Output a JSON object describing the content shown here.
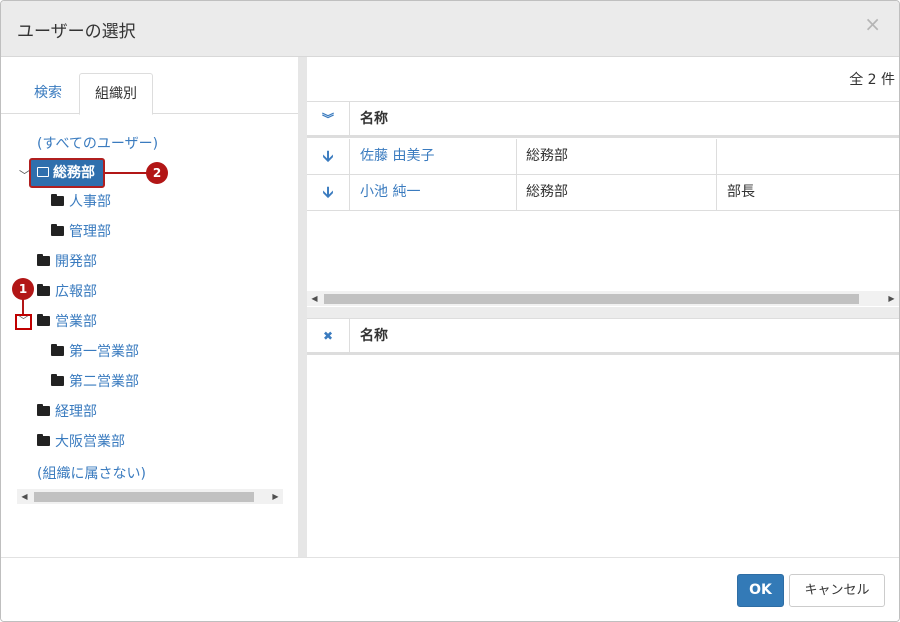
{
  "dialog": {
    "title": "ユーザーの選択",
    "close_icon": "×"
  },
  "left": {
    "tabs": [
      {
        "label": "検索"
      },
      {
        "label": "組織別"
      }
    ],
    "tree": {
      "all_users": "(すべてのユーザー)",
      "selected": "総務部",
      "children_selected": [
        "人事部",
        "管理部"
      ],
      "kaihatsu": "開発部",
      "kouhou": "広報部",
      "eigyou": "営業部",
      "children_eigyou": [
        "第一営業部",
        "第二営業部"
      ],
      "keiri": "経理部",
      "osaka": "大阪営業部",
      "no_org": "(組織に属さない)"
    },
    "badges": [
      "1",
      "2"
    ]
  },
  "right": {
    "count": "全 2 件",
    "upper": {
      "header_name": "名称",
      "rows": [
        {
          "name": "佐藤 由美子",
          "dept": "総務部",
          "title": ""
        },
        {
          "name": "小池 純一",
          "dept": "総務部",
          "title": "部長"
        }
      ]
    },
    "lower": {
      "header_name": "名称"
    }
  },
  "footer": {
    "ok_label": "OK",
    "cancel_label": "キャンセル"
  },
  "colors": {
    "accent": "#337ab7",
    "annotation": "#b21616",
    "link": "#3a7bbf"
  }
}
